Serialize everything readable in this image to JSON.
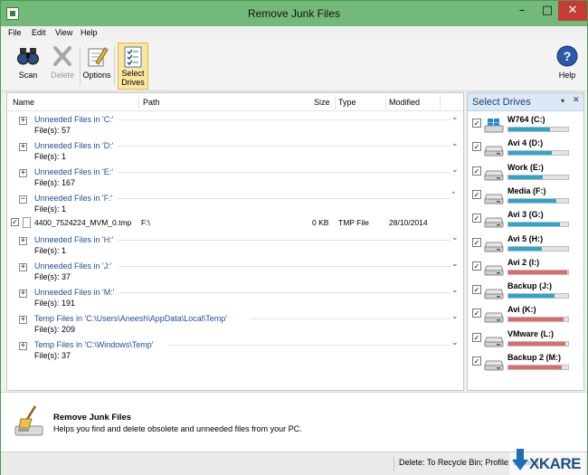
{
  "window": {
    "title": "Remove Junk Files"
  },
  "menu": {
    "file": "File",
    "edit": "Edit",
    "view": "View",
    "help": "Help"
  },
  "toolbar": {
    "scan": "Scan",
    "delete": "Delete",
    "options": "Options",
    "select_drives_1": "Select",
    "select_drives_2": "Drives",
    "help": "Help"
  },
  "columns": {
    "name": "Name",
    "path": "Path",
    "size": "Size",
    "type": "Type",
    "modified": "Modified"
  },
  "groups": [
    {
      "title": "Unneeded Files in 'C:'",
      "count": "File(s): 57",
      "expanded": false
    },
    {
      "title": "Unneeded Files in 'D:'",
      "count": "File(s): 1",
      "expanded": false
    },
    {
      "title": "Unneeded Files in 'E:'",
      "count": "File(s): 167",
      "expanded": false
    },
    {
      "title": "Unneeded Files in 'F:'",
      "count": "File(s): 1",
      "expanded": true
    },
    {
      "title": "Unneeded Files in 'H:'",
      "count": "File(s): 1",
      "expanded": false
    },
    {
      "title": "Unneeded Files in 'J:'",
      "count": "File(s): 37",
      "expanded": false
    },
    {
      "title": "Unneeded Files in 'M:'",
      "count": "File(s): 191",
      "expanded": false
    },
    {
      "title": "Temp Files in 'C:\\Users\\Aneesh\\AppData\\Local\\Temp'",
      "count": "File(s): 209",
      "expanded": false
    },
    {
      "title": "Temp Files in 'C:\\Windows\\Temp'",
      "count": "File(s): 37",
      "expanded": false
    }
  ],
  "file_row": {
    "name": "4400_7524224_MVM_0.tmp",
    "path": "F:\\",
    "size": "0 KB",
    "type": "TMP File",
    "modified": "28/10/2014",
    "checked": true
  },
  "drives_panel": {
    "title": "Select Drives",
    "drives": [
      {
        "name": "W764 (C:)",
        "used": 0.7,
        "color": "#2aa6c9",
        "checked": true,
        "system": true
      },
      {
        "name": "Avi 4 (D:)",
        "used": 0.72,
        "color": "#2aa6c9",
        "checked": true
      },
      {
        "name": "Work (E:)",
        "used": 0.58,
        "color": "#2aa6c9",
        "checked": true
      },
      {
        "name": "Media (F:)",
        "used": 0.8,
        "color": "#2aa6c9",
        "checked": true
      },
      {
        "name": "Avi 3 (G:)",
        "used": 0.86,
        "color": "#2aa6c9",
        "checked": true
      },
      {
        "name": "Avi 5 (H:)",
        "used": 0.56,
        "color": "#2aa6c9",
        "checked": true
      },
      {
        "name": "Avi 2 (I:)",
        "used": 0.98,
        "color": "#e06a6a",
        "checked": true
      },
      {
        "name": "Backup (J:)",
        "used": 0.78,
        "color": "#2aa6c9",
        "checked": true
      },
      {
        "name": "Avi (K:)",
        "used": 0.93,
        "color": "#e06a6a",
        "checked": true
      },
      {
        "name": "VMware (L:)",
        "used": 0.95,
        "color": "#e06a6a",
        "checked": true
      },
      {
        "name": "Backup 2 (M:)",
        "used": 0.9,
        "color": "#e06a6a",
        "checked": true
      }
    ]
  },
  "description": {
    "title": "Remove Junk Files",
    "text": "Helps you find and delete obsolete and unneeded files from your PC."
  },
  "status": {
    "text": "Delete: To Recycle Bin; Profile: Default"
  },
  "watermark": "XKARE"
}
